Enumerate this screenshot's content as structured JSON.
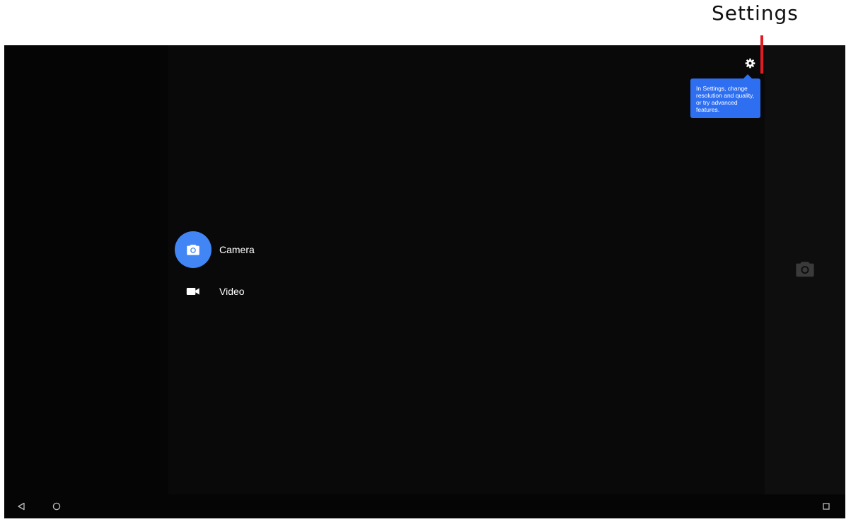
{
  "annotation": {
    "label": "Settings",
    "line_color": "#e01b24"
  },
  "camera_app": {
    "settings": {
      "icon": "gear-icon",
      "tooltip": "In Settings, change resolution and quality, or try advanced features."
    },
    "tooltip_color": "#2e6ff2",
    "modes": [
      {
        "label": "Camera",
        "icon": "camera-icon",
        "active": true
      },
      {
        "label": "Video",
        "icon": "video-camera-icon",
        "active": false
      }
    ],
    "accent_color": "#4285f4",
    "shutter_icon": "camera-icon"
  },
  "navigation_bar": {
    "buttons": [
      "back-icon",
      "home-icon",
      "recents-icon"
    ]
  }
}
